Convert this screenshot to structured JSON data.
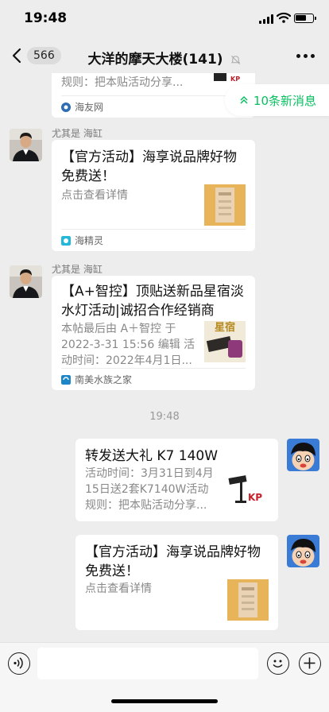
{
  "status_bar": {
    "time": "19:48"
  },
  "nav": {
    "back_count": "566",
    "title": "大洋的摩天大楼(141)"
  },
  "new_messages": {
    "label": "10条新消息"
  },
  "top_card": {
    "desc_tail": "规则：把本贴活动分享...",
    "source": "海友网"
  },
  "messages": [
    {
      "sender": "尤其是 海缸",
      "title": "【官方活动】海享说品牌好物免费送！",
      "desc": "点击查看详情",
      "source": "海精灵"
    },
    {
      "sender": "尤其是 海缸",
      "title": "【A+智控】顶贴送新品星宿淡水灯活动|诚招合作经销商",
      "desc_lines": [
        "本帖最后由 A＋智控 于",
        "2022-3-31 15:56 编辑 活",
        "动时间：2022年4月1日..."
      ],
      "thumb_label": "星宿",
      "source": "南美水族之家"
    }
  ],
  "timestamp": "19:48",
  "my_messages": [
    {
      "title": "转发送大礼 K7 140W",
      "desc_lines": [
        "活动时间：3月31日到4月",
        "15日送2套K7140W活动",
        "规则：把本贴活动分享..."
      ]
    },
    {
      "title": "【官方活动】海享说品牌好物免费送！",
      "desc": "点击查看详情"
    }
  ],
  "colors": {
    "accent": "#07c160",
    "background": "#ededed"
  }
}
